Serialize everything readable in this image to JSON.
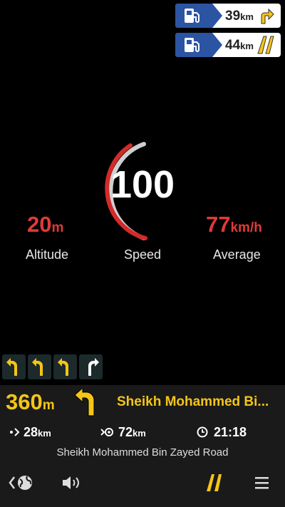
{
  "poi_cards": [
    {
      "distance": "39",
      "unit": "km",
      "type_icon": "fuel-station-icon",
      "direction_icon": "turn-right-icon"
    },
    {
      "distance": "44",
      "unit": "km",
      "type_icon": "fuel-station-icon",
      "direction_icon": "road-ahead-icon"
    }
  ],
  "colors": {
    "accent_yellow": "#f5c518",
    "stat_red": "#e03a3a",
    "poi_blue": "#2b54a3"
  },
  "speed": {
    "value": "100",
    "label": "Speed"
  },
  "altitude": {
    "value": "20",
    "unit": "m",
    "label": "Altitude"
  },
  "average": {
    "value": "77",
    "unit": "km/h",
    "label": "Average"
  },
  "lanes": [
    "left-turn",
    "left-turn",
    "left-turn",
    "right-turn"
  ],
  "navigation": {
    "turn_distance": "360",
    "turn_unit": "m",
    "next_street": "Sheikh Mohammed Bi...",
    "remaining_distance": "28",
    "remaining_unit": "km",
    "total_distance": "72",
    "total_unit": "km",
    "arrival_time": "21:18",
    "current_road": "Sheikh Mohammed Bin Zayed Road"
  },
  "toolbar_icons": [
    "back-globe-icon",
    "volume-icon",
    "road-view-icon",
    "menu-icon"
  ]
}
